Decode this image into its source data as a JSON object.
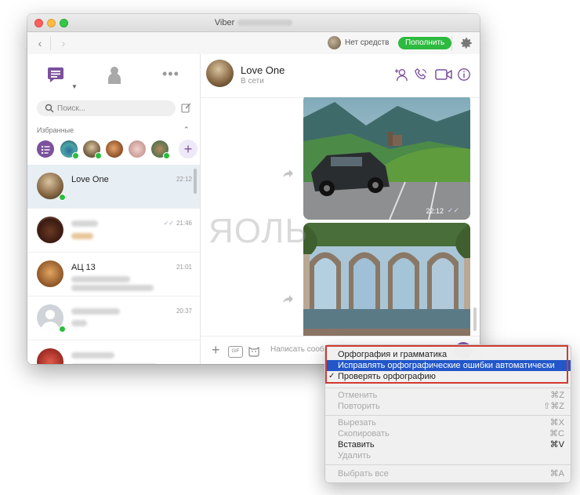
{
  "window": {
    "app_title": "Viber"
  },
  "toolbar": {
    "balance_text": "Нет средств",
    "topup_label": "Пополнить"
  },
  "sidebar": {
    "search_placeholder": "Поиск...",
    "favorites_label": "Избранные",
    "chats": [
      {
        "name": "Love One",
        "time": "22:12",
        "online": true,
        "active": true
      },
      {
        "name": "",
        "time": "21:46",
        "online": false,
        "active": false
      },
      {
        "name": "АЦ 13",
        "time": "21:01",
        "online": false,
        "active": false
      },
      {
        "name": "",
        "time": "20:37",
        "online": true,
        "active": false
      },
      {
        "name": "",
        "time": "",
        "online": false,
        "active": false
      }
    ]
  },
  "conversation": {
    "contact_name": "Love One",
    "contact_status": "В сети",
    "photo_time": "22:12",
    "composer_placeholder": "Написать сооб",
    "watermark": "ЯОЛЬ"
  },
  "context_menu": {
    "items": [
      {
        "label": "Орфография и грамматика",
        "shortcut": "",
        "disabled": false,
        "selected": false,
        "checked": false
      },
      {
        "label": "Исправлять орфографические ошибки автоматически",
        "shortcut": "",
        "disabled": false,
        "selected": true,
        "checked": false
      },
      {
        "label": "Проверять орфографию",
        "shortcut": "",
        "disabled": false,
        "selected": false,
        "checked": true
      },
      {
        "label": "Отменить",
        "shortcut": "⌘Z",
        "disabled": true
      },
      {
        "label": "Повторить",
        "shortcut": "⇧⌘Z",
        "disabled": true
      },
      {
        "label": "Вырезать",
        "shortcut": "⌘X",
        "disabled": true
      },
      {
        "label": "Скопировать",
        "shortcut": "⌘C",
        "disabled": true
      },
      {
        "label": "Вставить",
        "shortcut": "⌘V",
        "disabled": false
      },
      {
        "label": "Удалить",
        "shortcut": "",
        "disabled": true
      },
      {
        "label": "Выбрать все",
        "shortcut": "⌘A",
        "disabled": true
      }
    ]
  },
  "colors": {
    "viber_purple": "#7b519d",
    "topup_green": "#2dba3f",
    "online_green": "#2bbd3d",
    "menu_selection": "#2256c9",
    "highlight_red": "#d13a30"
  }
}
